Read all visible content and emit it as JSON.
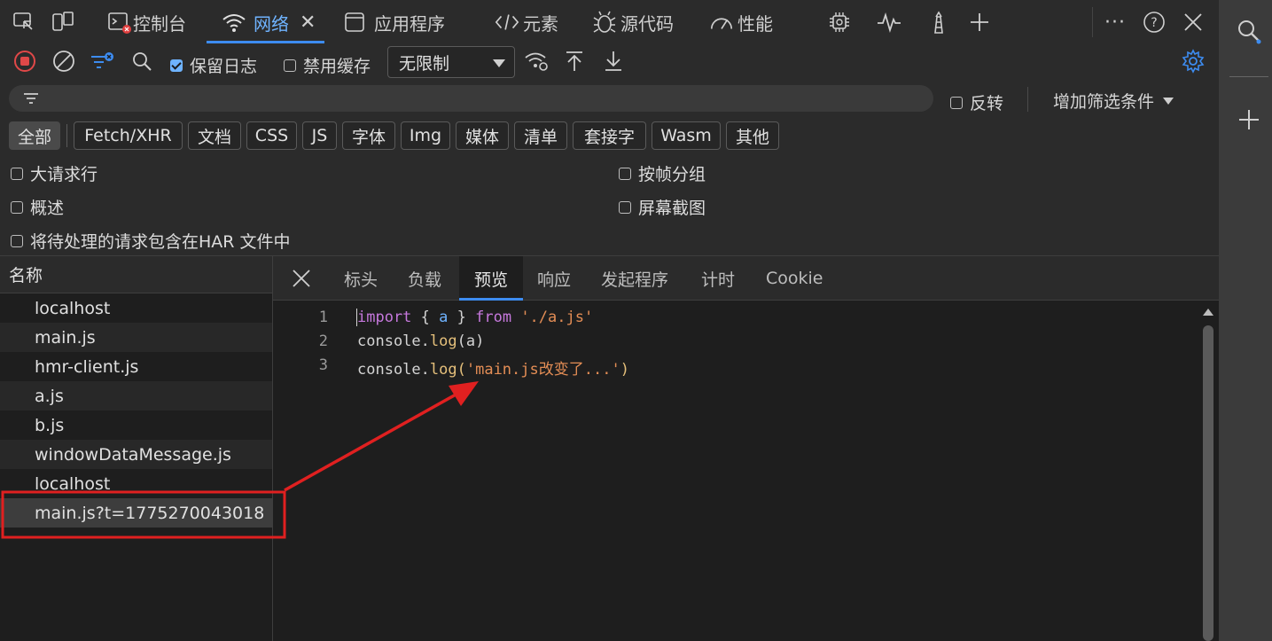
{
  "tabs": {
    "console_label": "控制台",
    "network_label": "网络",
    "application_label": "应用程序",
    "elements_label": "元素",
    "sources_label": "源代码",
    "performance_label": "性能"
  },
  "toolbar": {
    "preserve_log_label": "保留日志",
    "preserve_log_checked": true,
    "disable_cache_label": "禁用缓存",
    "disable_cache_checked": false,
    "throttling_value": "无限制"
  },
  "filter": {
    "invert_label": "反转",
    "more_filters_label": "增加筛选条件"
  },
  "resource_types": [
    "全部",
    "Fetch/XHR",
    "文档",
    "CSS",
    "JS",
    "字体",
    "Img",
    "媒体",
    "清单",
    "套接字",
    "Wasm",
    "其他"
  ],
  "options": {
    "big_request_rows": "大请求行",
    "group_by_frame": "按帧分组",
    "overview": "概述",
    "screenshots": "屏幕截图",
    "har_pending": "将待处理的请求包含在HAR 文件中"
  },
  "request_list": {
    "header": "名称",
    "rows": [
      "localhost",
      "main.js",
      "hmr-client.js",
      "a.js",
      "b.js",
      "windowDataMessage.js",
      "localhost",
      "main.js?t=1775270043018"
    ],
    "selected_index": 7
  },
  "detail_tabs": {
    "headers": "标头",
    "payload": "负载",
    "preview": "预览",
    "response": "响应",
    "initiator": "发起程序",
    "timing": "计时",
    "cookie": "Cookie"
  },
  "code": {
    "line_numbers": [
      "1",
      "2",
      "3"
    ],
    "line1": {
      "kw1": "import",
      "brace_open": " { ",
      "ident": "a",
      "brace_close": " } ",
      "kw2": "from",
      "space": " ",
      "str": "'./a.js'"
    },
    "line2": {
      "obj": "console.",
      "fn": "log",
      "args": "(a)"
    },
    "line3": {
      "obj": "console.",
      "fn": "log",
      "paren_open": "(",
      "str": "'main.js改变了...'",
      "paren_close": ")"
    }
  },
  "colors": {
    "accent": "#3d8cf0",
    "annotation_red": "#e02020"
  }
}
